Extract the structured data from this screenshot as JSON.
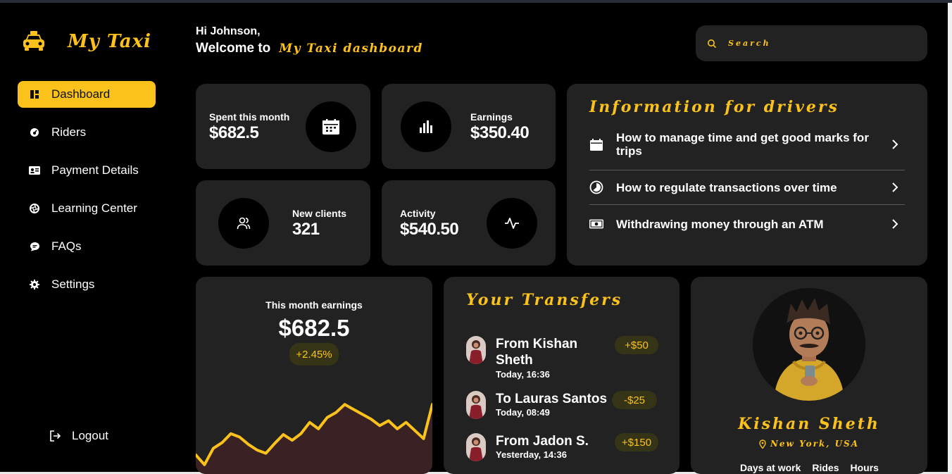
{
  "app": {
    "name": "My Taxi"
  },
  "sidebar": {
    "items": [
      {
        "label": "Dashboard",
        "icon": "dashboard-icon",
        "active": true
      },
      {
        "label": "Riders",
        "icon": "gauge-icon",
        "active": false
      },
      {
        "label": "Payment Details",
        "icon": "id-card-icon",
        "active": false
      },
      {
        "label": "Learning Center",
        "icon": "aperture-icon",
        "active": false
      },
      {
        "label": "FAQs",
        "icon": "chat-bubble-icon",
        "active": false
      },
      {
        "label": "Settings",
        "icon": "gear-icon",
        "active": false
      }
    ],
    "logout_label": "Logout"
  },
  "header": {
    "greeting": "Hi Johnson,",
    "welcome": "Welcome to",
    "brand": "My Taxi dashboard",
    "search_placeholder": "Search"
  },
  "stats": {
    "spent": {
      "label": "Spent this month",
      "value": "$682.5"
    },
    "earnings": {
      "label": "Earnings",
      "value": "$350.40"
    },
    "new_clients": {
      "label": "New clients",
      "value": "321"
    },
    "activity": {
      "label": "Activity",
      "value": "$540.50"
    }
  },
  "info": {
    "title": "Information for drivers",
    "items": [
      {
        "text": "How to manage time and get good marks for trips",
        "icon": "calendar-icon"
      },
      {
        "text": "How to regulate transactions over time",
        "icon": "pie-icon"
      },
      {
        "text": "Withdrawing money through an ATM",
        "icon": "banknote-icon"
      }
    ]
  },
  "earnings_card": {
    "label": "This month earnings",
    "value": "$682.5",
    "change": "+2.45%",
    "series": [
      20,
      8,
      28,
      35,
      46,
      42,
      33,
      26,
      22,
      34,
      45,
      38,
      46,
      60,
      52,
      66,
      72,
      82,
      76,
      70,
      64,
      56,
      62,
      52,
      60,
      50,
      40,
      82
    ]
  },
  "transfers": {
    "title": "Your Transfers",
    "items": [
      {
        "name": "From Kishan Sheth",
        "time": "Today, 16:36",
        "amount": "+$50"
      },
      {
        "name": "To Lauras Santos",
        "time": "Today, 08:49",
        "amount": "-$25"
      },
      {
        "name": "From Jadon S.",
        "time": "Yesterday, 14:36",
        "amount": "+$150"
      }
    ]
  },
  "profile": {
    "name": "Kishan Sheth",
    "location": "New York, USA",
    "stats": [
      "Days at work",
      "Rides",
      "Hours"
    ]
  },
  "colors": {
    "accent": "#fbc21c",
    "card": "#222222",
    "background": "#000000"
  }
}
